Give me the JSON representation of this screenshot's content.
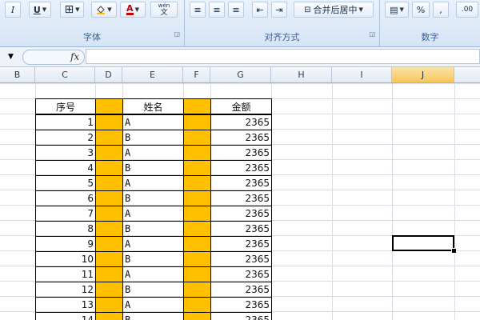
{
  "ribbon": {
    "font_group": {
      "label": "字体",
      "italic": "I",
      "underline": "U",
      "font_color": "A",
      "phonetic_top": "wén",
      "phonetic_bottom": "文"
    },
    "align_group": {
      "label": "对齐方式",
      "merge_label": "合并后居中"
    },
    "number_group": {
      "label": "数字",
      "percent": "%",
      "comma": ",",
      "decimal": ".00"
    }
  },
  "formula_bar": {
    "fx": "fx",
    "value": ""
  },
  "columns": [
    "B",
    "C",
    "D",
    "E",
    "F",
    "G",
    "H",
    "I",
    "J"
  ],
  "selected_column": "J",
  "table": {
    "headers": {
      "seq": "序号",
      "name": "姓名",
      "amount": "金额"
    },
    "rows": [
      {
        "seq": "1",
        "name": "A",
        "amount": "2365"
      },
      {
        "seq": "2",
        "name": "B",
        "amount": "2365"
      },
      {
        "seq": "3",
        "name": "A",
        "amount": "2365"
      },
      {
        "seq": "4",
        "name": "B",
        "amount": "2365"
      },
      {
        "seq": "5",
        "name": "A",
        "amount": "2365"
      },
      {
        "seq": "6",
        "name": "B",
        "amount": "2365"
      },
      {
        "seq": "7",
        "name": "A",
        "amount": "2365"
      },
      {
        "seq": "8",
        "name": "B",
        "amount": "2365"
      },
      {
        "seq": "9",
        "name": "A",
        "amount": "2365"
      },
      {
        "seq": "10",
        "name": "B",
        "amount": "2365"
      },
      {
        "seq": "11",
        "name": "A",
        "amount": "2365"
      },
      {
        "seq": "12",
        "name": "B",
        "amount": "2365"
      },
      {
        "seq": "13",
        "name": "A",
        "amount": "2365"
      },
      {
        "seq": "14",
        "name": "B",
        "amount": "2365"
      }
    ]
  },
  "colors": {
    "highlight": "#ffc000",
    "ribbon": "#dbe7f7"
  }
}
